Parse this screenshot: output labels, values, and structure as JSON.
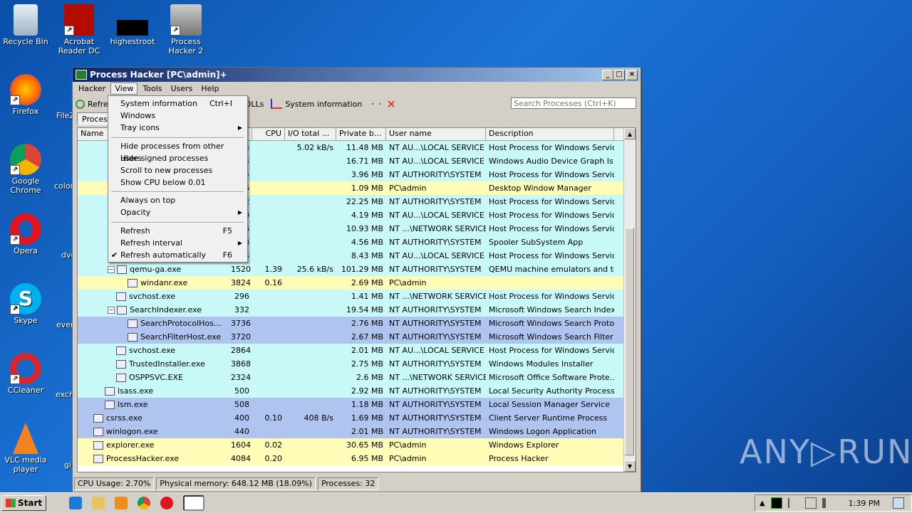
{
  "desktop": {
    "icons": [
      {
        "label": "Recycle Bin"
      },
      {
        "label": "Acrobat Reader DC"
      },
      {
        "label": "highestroot"
      },
      {
        "label": "Process Hacker 2"
      },
      {
        "label": "Firefox"
      },
      {
        "label": "Google Chrome"
      },
      {
        "label": "Opera"
      },
      {
        "label": "Skype"
      },
      {
        "label": "CCleaner"
      },
      {
        "label": "VLC media player"
      }
    ],
    "partial_labels": [
      "FileZ",
      "color",
      "dvd",
      "ever",
      "exch",
      "gi"
    ]
  },
  "window": {
    "title": "Process Hacker [PC\\admin]+",
    "menu": [
      "Hacker",
      "View",
      "Tools",
      "Users",
      "Help"
    ],
    "toolbar": {
      "refresh": "Refre",
      "dlls": "DLLs",
      "sysinfo": "System information"
    },
    "search_placeholder": "Search Processes (Ctrl+K)",
    "tab": "Process",
    "columns": [
      "Name",
      "D",
      "CPU",
      "I/O total ...",
      "Private b...",
      "User name",
      "Description"
    ]
  },
  "view_menu": {
    "items": [
      {
        "label": "System information",
        "shortcut": "Ctrl+I"
      },
      {
        "label": "Windows",
        "shortcut": ""
      },
      {
        "label": "Tray icons",
        "shortcut": ""
      },
      {
        "label": "Hide processes from other users",
        "shortcut": ""
      },
      {
        "label": "Hide signed processes",
        "shortcut": ""
      },
      {
        "label": "Scroll to new processes",
        "shortcut": ""
      },
      {
        "label": "Show CPU below 0.01",
        "shortcut": ""
      },
      {
        "label": "Always on top",
        "shortcut": ""
      },
      {
        "label": "Opacity",
        "shortcut": ""
      },
      {
        "label": "Refresh",
        "shortcut": "F5"
      },
      {
        "label": "Refresh interval",
        "shortcut": ""
      },
      {
        "label": "Refresh automatically",
        "shortcut": "F6"
      }
    ]
  },
  "processes": [
    {
      "name": "",
      "pid": "4",
      "cpu": "",
      "io": "5.02 kB/s",
      "priv": "11.48 MB",
      "user": "NT AU...\\LOCAL SERVICE",
      "desc": "Host Process for Windows Services",
      "bg": "#c8f8f8"
    },
    {
      "name": "",
      "pid": "4",
      "cpu": "",
      "io": "",
      "priv": "16.71 MB",
      "user": "NT AU...\\LOCAL SERVICE",
      "desc": "Windows Audio Device Graph Is...",
      "bg": "#c8f8f8"
    },
    {
      "name": "",
      "pid": "4",
      "cpu": "",
      "io": "",
      "priv": "3.96 MB",
      "user": "NT AUTHORITY\\SYSTEM",
      "desc": "Host Process for Windows Services",
      "bg": "#c8f8f8"
    },
    {
      "name": "",
      "pid": "6",
      "cpu": "",
      "io": "",
      "priv": "1.09 MB",
      "user": "PC\\admin",
      "desc": "Desktop Window Manager",
      "bg": "#fffcb8"
    },
    {
      "name": "",
      "pid": "2",
      "cpu": "",
      "io": "",
      "priv": "22.25 MB",
      "user": "NT AUTHORITY\\SYSTEM",
      "desc": "Host Process for Windows Services",
      "bg": "#c8f8f8"
    },
    {
      "name": "",
      "pid": "0",
      "cpu": "",
      "io": "",
      "priv": "4.19 MB",
      "user": "NT AU...\\LOCAL SERVICE",
      "desc": "Host Process for Windows Services",
      "bg": "#c8f8f8"
    },
    {
      "name": "",
      "pid": "6",
      "cpu": "",
      "io": "",
      "priv": "10.93 MB",
      "user": "NT ...\\NETWORK SERVICE",
      "desc": "Host Process for Windows Services",
      "bg": "#c8f8f8"
    },
    {
      "name": "",
      "pid": "8",
      "cpu": "",
      "io": "",
      "priv": "4.56 MB",
      "user": "NT AUTHORITY\\SYSTEM",
      "desc": "Spooler SubSystem App",
      "bg": "#c8f8f8"
    },
    {
      "name": "",
      "pid": "4",
      "cpu": "",
      "io": "",
      "priv": "8.43 MB",
      "user": "NT AU...\\LOCAL SERVICE",
      "desc": "Host Process for Windows Services",
      "bg": "#c8f8f8"
    },
    {
      "name": "qemu-ga.exe",
      "pid": "1520",
      "cpu": "1.39",
      "io": "25.6 kB/s",
      "priv": "101.29 MB",
      "user": "NT AUTHORITY\\SYSTEM",
      "desc": "QEMU machine emulators and tools",
      "bg": "#c8f8f8",
      "indent": 3,
      "expand": true
    },
    {
      "name": "windanr.exe",
      "pid": "3824",
      "cpu": "0.16",
      "io": "",
      "priv": "2.69 MB",
      "user": "PC\\admin",
      "desc": "",
      "bg": "#fffcb8",
      "indent": 4
    },
    {
      "name": "svchost.exe",
      "pid": "296",
      "cpu": "",
      "io": "",
      "priv": "1.41 MB",
      "user": "NT ...\\NETWORK SERVICE",
      "desc": "Host Process for Windows Services",
      "bg": "#c8f8f8",
      "indent": 3
    },
    {
      "name": "SearchIndexer.exe",
      "pid": "332",
      "cpu": "",
      "io": "",
      "priv": "19.54 MB",
      "user": "NT AUTHORITY\\SYSTEM",
      "desc": "Microsoft Windows Search Indexer",
      "bg": "#c8f8f8",
      "indent": 3,
      "expand": true
    },
    {
      "name": "SearchProtocolHos...",
      "pid": "3736",
      "cpu": "",
      "io": "",
      "priv": "2.76 MB",
      "user": "NT AUTHORITY\\SYSTEM",
      "desc": "Microsoft Windows Search Proto...",
      "bg": "#b0c4f0",
      "indent": 4
    },
    {
      "name": "SearchFilterHost.exe",
      "pid": "3720",
      "cpu": "",
      "io": "",
      "priv": "2.67 MB",
      "user": "NT AUTHORITY\\SYSTEM",
      "desc": "Microsoft Windows Search Filter ...",
      "bg": "#b0c4f0",
      "indent": 4
    },
    {
      "name": "svchost.exe",
      "pid": "2864",
      "cpu": "",
      "io": "",
      "priv": "2.01 MB",
      "user": "NT AU...\\LOCAL SERVICE",
      "desc": "Host Process for Windows Services",
      "bg": "#c8f8f8",
      "indent": 3
    },
    {
      "name": "TrustedInstaller.exe",
      "pid": "3868",
      "cpu": "",
      "io": "",
      "priv": "2.75 MB",
      "user": "NT AUTHORITY\\SYSTEM",
      "desc": "Windows Modules Installer",
      "bg": "#c8f8f8",
      "indent": 3
    },
    {
      "name": "OSPPSVC.EXE",
      "pid": "2324",
      "cpu": "",
      "io": "",
      "priv": "2.6 MB",
      "user": "NT ...\\NETWORK SERVICE",
      "desc": "Microsoft Office Software Prote...",
      "bg": "#c8f8f8",
      "indent": 3
    },
    {
      "name": "lsass.exe",
      "pid": "500",
      "cpu": "",
      "io": "",
      "priv": "2.92 MB",
      "user": "NT AUTHORITY\\SYSTEM",
      "desc": "Local Security Authority Process",
      "bg": "#c8f8f8",
      "indent": 2
    },
    {
      "name": "lsm.exe",
      "pid": "508",
      "cpu": "",
      "io": "",
      "priv": "1.18 MB",
      "user": "NT AUTHORITY\\SYSTEM",
      "desc": "Local Session Manager Service",
      "bg": "#b0c4f0",
      "indent": 2
    },
    {
      "name": "csrss.exe",
      "pid": "400",
      "cpu": "0.10",
      "io": "408 B/s",
      "priv": "1.69 MB",
      "user": "NT AUTHORITY\\SYSTEM",
      "desc": "Client Server Runtime Process",
      "bg": "#b0c4f0",
      "indent": 1
    },
    {
      "name": "winlogon.exe",
      "pid": "440",
      "cpu": "",
      "io": "",
      "priv": "2.01 MB",
      "user": "NT AUTHORITY\\SYSTEM",
      "desc": "Windows Logon Application",
      "bg": "#b0c4f0",
      "indent": 1
    },
    {
      "name": "explorer.exe",
      "pid": "1604",
      "cpu": "0.02",
      "io": "",
      "priv": "30.65 MB",
      "user": "PC\\admin",
      "desc": "Windows Explorer",
      "bg": "#fffcb8",
      "indent": 1
    },
    {
      "name": "ProcessHacker.exe",
      "pid": "4084",
      "cpu": "0.20",
      "io": "",
      "priv": "6.95 MB",
      "user": "PC\\admin",
      "desc": "Process Hacker",
      "bg": "#fffcb8",
      "indent": 1
    }
  ],
  "status": {
    "cpu": "CPU Usage: 2.70%",
    "memory": "Physical memory: 648.12 MB (18.09%)",
    "processes": "Processes: 32"
  },
  "taskbar": {
    "start": "Start",
    "clock": "1:39 PM"
  },
  "watermark": "ANY▷RUN"
}
